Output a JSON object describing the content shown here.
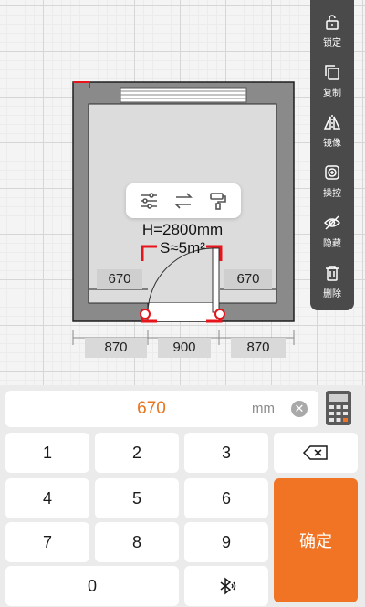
{
  "room": {
    "height_text": "H=2800mm",
    "area_text": "S≈5m²",
    "left_wall_dim": "670",
    "right_wall_dim": "670",
    "bottom_dims": [
      "870",
      "900",
      "870"
    ]
  },
  "popup": {
    "icons": [
      "sliders-icon",
      "swap-icon",
      "paint-roller-icon"
    ]
  },
  "toolbar": {
    "items": [
      {
        "label": "锁定",
        "icon": "lock-icon"
      },
      {
        "label": "复制",
        "icon": "copy-icon"
      },
      {
        "label": "镜像",
        "icon": "mirror-icon"
      },
      {
        "label": "操控",
        "icon": "control-icon"
      },
      {
        "label": "隐藏",
        "icon": "hide-icon"
      },
      {
        "label": "删除",
        "icon": "trash-icon"
      }
    ]
  },
  "input": {
    "value": "670",
    "unit": "mm"
  },
  "keypad": {
    "keys": [
      "1",
      "2",
      "3",
      "4",
      "5",
      "6",
      "7",
      "8",
      "9",
      "0"
    ],
    "confirm_label": "确定"
  },
  "colors": {
    "accent": "#f07424",
    "marker": "#e8141c",
    "wall": "#8a8a8a",
    "toolbar": "#4a4a4a"
  }
}
